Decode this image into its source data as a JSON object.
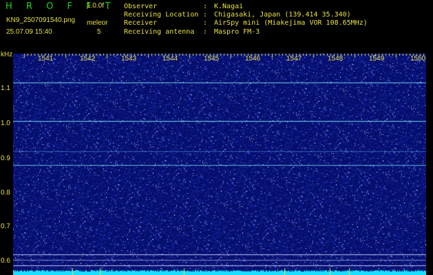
{
  "header": {
    "app_title": "H R O F F T",
    "version": "1.0.0f",
    "filename": "KN9_2507091540.png",
    "meleor_label": "meleor",
    "meleor_value": "5",
    "datetime": "25.07.09 15:40"
  },
  "info": [
    {
      "key": "Observer",
      "value": "K.Nagai"
    },
    {
      "key": "Receiving Location",
      "value": "Chigasaki, Japan (139.414 35.340)"
    },
    {
      "key": "Receiver",
      "value": "AirSpy mini (Miakejima VOR 108.65MHz)"
    },
    {
      "key": "Receiving antenna",
      "value": "Maspro FM-3"
    }
  ],
  "axis": {
    "y_unit": "kHz",
    "y_ticks": [
      "1.1",
      "1.0",
      "0.9",
      "0.8",
      "0.7",
      "0.6"
    ],
    "x_ticks": [
      "1541",
      "1542",
      "1543",
      "1544",
      "1545",
      "1546",
      "1547",
      "1548",
      "1549",
      "1550"
    ]
  },
  "colors": {
    "background": "#000000",
    "label": "#e8e040",
    "title": "#1fd11f",
    "plot_bg": "#0a1670",
    "signal": "#7ff0ff"
  }
}
